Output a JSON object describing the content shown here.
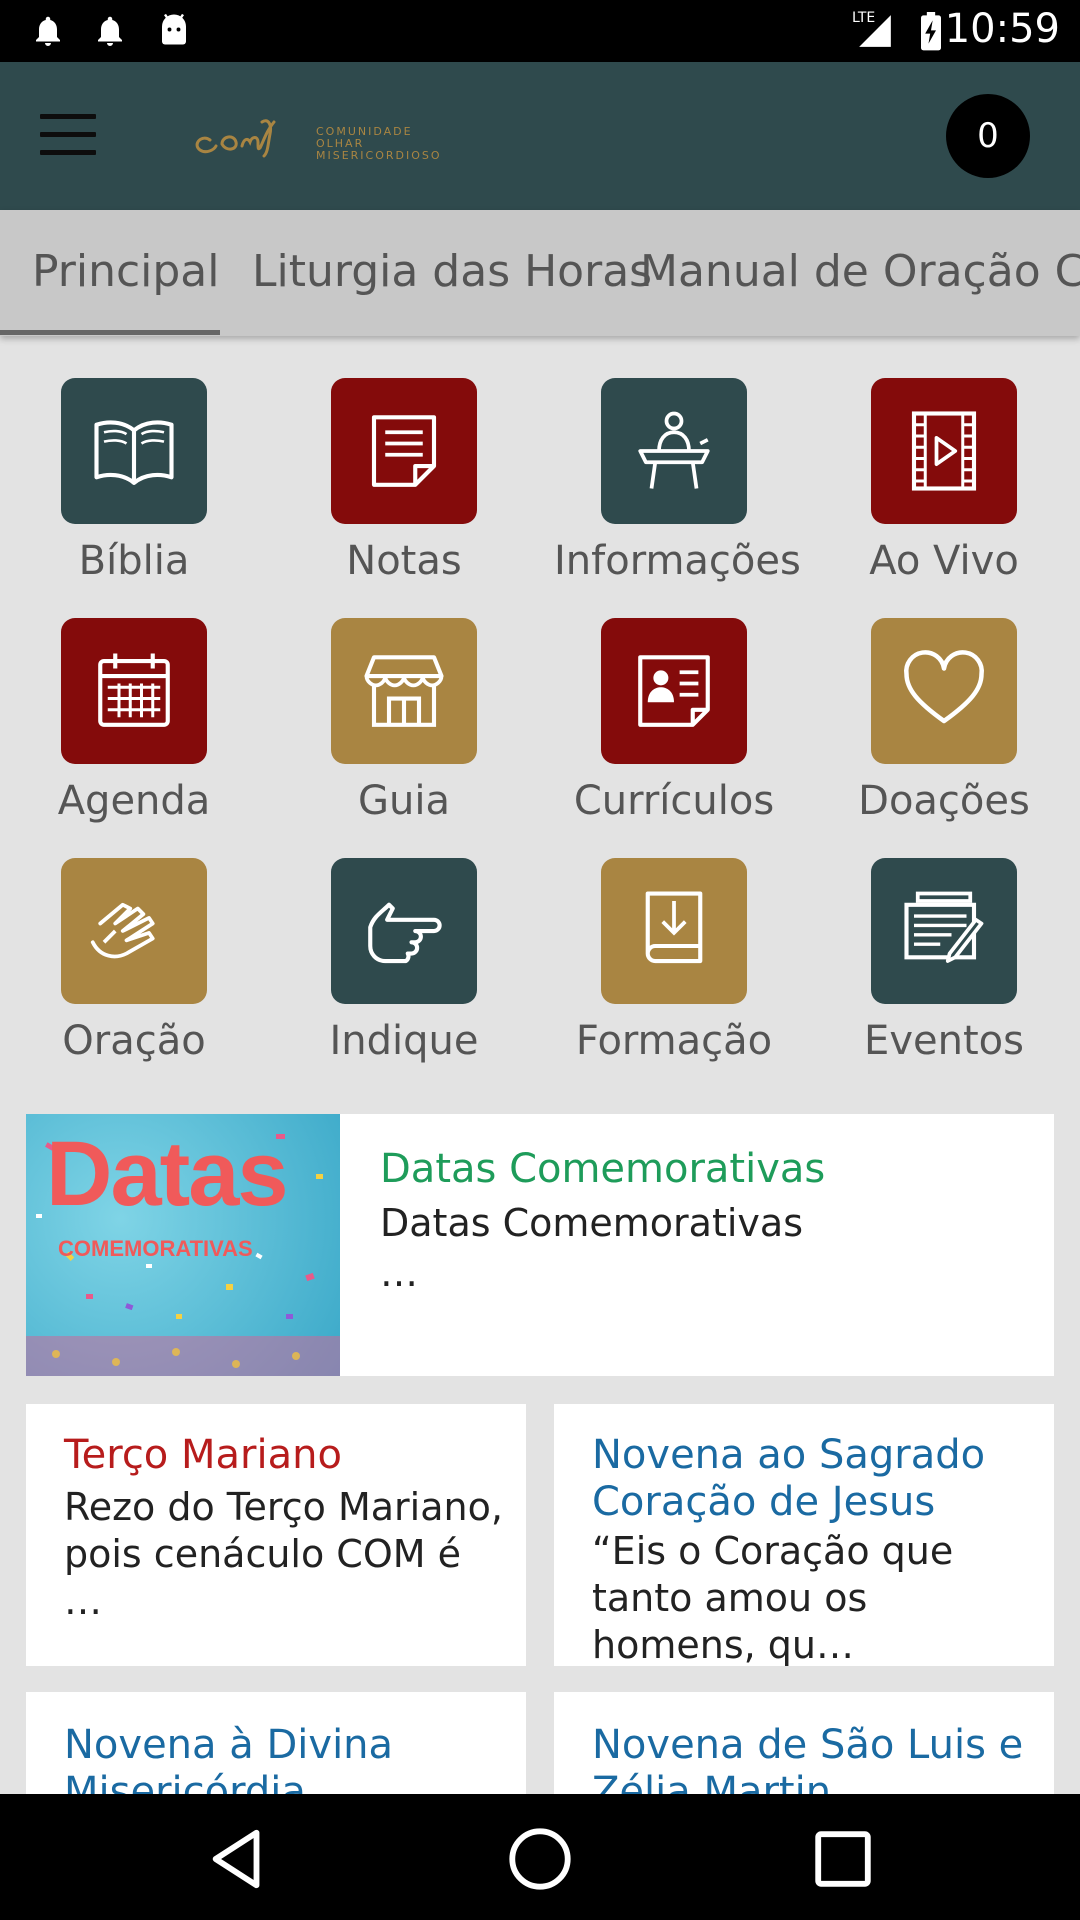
{
  "status_bar": {
    "time": "10:59",
    "network": "LTE"
  },
  "app_bar": {
    "cart_count": "0",
    "logo_subtitle": [
      "COMUNIDADE",
      "OLHAR",
      "MISERICORDIOSO"
    ]
  },
  "tabs": [
    {
      "label": "Principal",
      "selected": true
    },
    {
      "label": "Liturgia das Horas",
      "selected": false
    },
    {
      "label": "Manual de Oração COM",
      "selected": false
    }
  ],
  "grid": [
    {
      "label": "Bíblia",
      "icon": "book-icon",
      "color": "#2f4a4d"
    },
    {
      "label": "Notas",
      "icon": "note-icon",
      "color": "#840b0b"
    },
    {
      "label": "Informações",
      "icon": "podium-speaker-icon",
      "color": "#2f4a4d"
    },
    {
      "label": "Ao Vivo",
      "icon": "video-play-icon",
      "color": "#840b0b"
    },
    {
      "label": "Agenda",
      "icon": "calendar-icon",
      "color": "#840b0b"
    },
    {
      "label": "Guia",
      "icon": "store-icon",
      "color": "#a98542"
    },
    {
      "label": "Currículos",
      "icon": "contact-card-icon",
      "color": "#840b0b"
    },
    {
      "label": "Doações",
      "icon": "heart-icon",
      "color": "#a98542"
    },
    {
      "label": "Oração",
      "icon": "praying-hands-icon",
      "color": "#a98542"
    },
    {
      "label": "Indique",
      "icon": "pointing-hand-icon",
      "color": "#2f4a4d"
    },
    {
      "label": "Formação",
      "icon": "download-book-icon",
      "color": "#a98542"
    },
    {
      "label": "Eventos",
      "icon": "document-edit-icon",
      "color": "#2f4a4d"
    }
  ],
  "featured": {
    "image_text_big": "Datas",
    "image_text_small": "COMEMORATIVAS",
    "title": "Datas Comemorativas",
    "text": "Datas Comemorativas",
    "more": "…",
    "title_color": "#1e9c5a"
  },
  "cards": [
    {
      "title": "Terço Mariano",
      "title_color": "#b71c1c",
      "text": "Rezo do Terço Mariano, pois cenáculo COM é …"
    },
    {
      "title": "Novena ao Sagrado Coração de Jesus",
      "title_color": "#1a6aa2",
      "text": "“Eis o Coração que tanto amou os homens, qu…"
    },
    {
      "title": "Novena à Divina Misericórdia",
      "title_color": "#1a6aa2",
      "text": ""
    },
    {
      "title": "Novena de São Luis e Zélia Martin",
      "title_color": "#1a6aa2",
      "text": ""
    }
  ]
}
